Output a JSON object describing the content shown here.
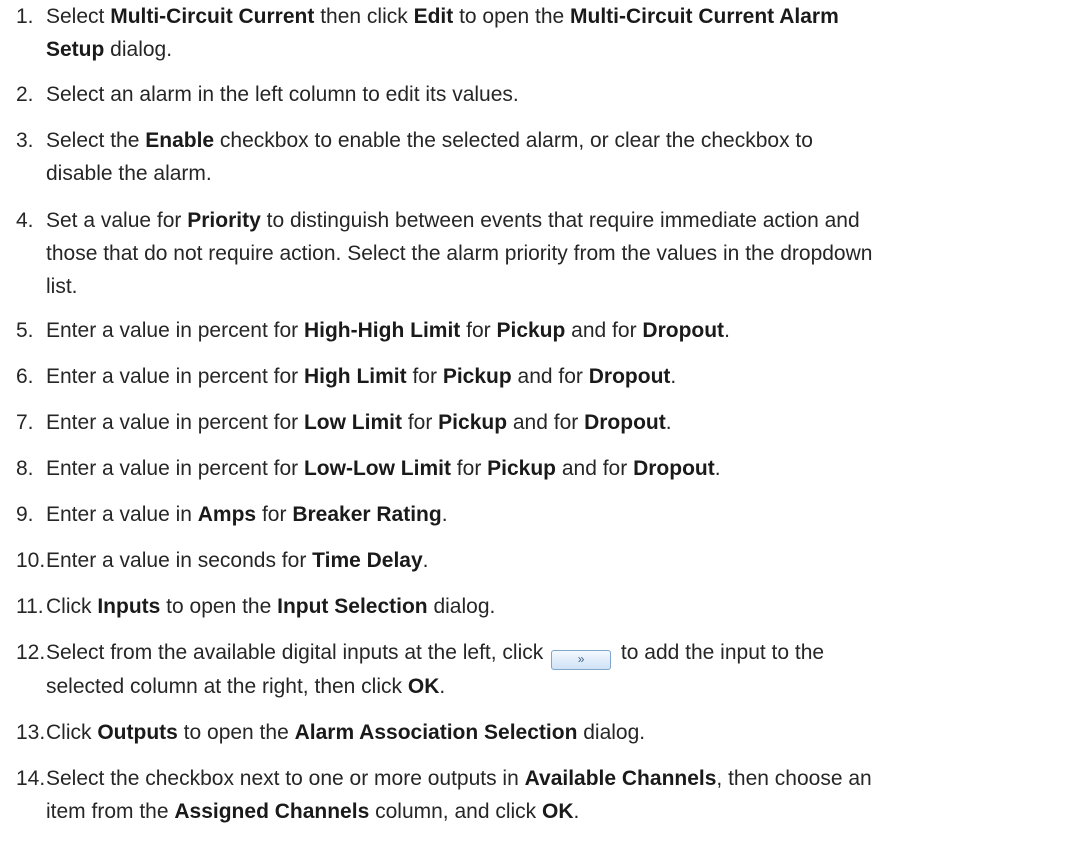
{
  "steps": [
    {
      "num": "1.",
      "parts": [
        {
          "t": "Select "
        },
        {
          "b": "Multi-Circuit Current"
        },
        {
          "t": " then click "
        },
        {
          "b": "Edit"
        },
        {
          "t": " to open the "
        },
        {
          "b": "Multi-Circuit Current Alarm"
        },
        {
          "br": true
        },
        {
          "b": "Setup"
        },
        {
          "t": " dialog."
        }
      ]
    },
    {
      "num": "2.",
      "parts": [
        {
          "t": "Select an alarm in the left column to edit its values."
        }
      ]
    },
    {
      "num": "3.",
      "parts": [
        {
          "t": "Select the "
        },
        {
          "b": "Enable"
        },
        {
          "t": " checkbox to enable the selected alarm, or clear the checkbox to"
        },
        {
          "br": true
        },
        {
          "t": "disable the alarm."
        }
      ]
    },
    {
      "num": "4.",
      "parts": [
        {
          "t": "Set a value for "
        },
        {
          "b": "Priority"
        },
        {
          "t": " to distinguish between events that require immediate action and"
        },
        {
          "br": true
        },
        {
          "t": "those that do not require action. Select the alarm priority from the values in the dropdown"
        },
        {
          "br": true
        },
        {
          "t": "list."
        }
      ]
    },
    {
      "num": "5.",
      "parts": [
        {
          "t": "Enter a value in percent for "
        },
        {
          "b": "High-High Limit"
        },
        {
          "t": " for "
        },
        {
          "b": "Pickup"
        },
        {
          "t": " and for "
        },
        {
          "b": "Dropout"
        },
        {
          "t": "."
        }
      ]
    },
    {
      "num": "6.",
      "parts": [
        {
          "t": "Enter a value in percent for "
        },
        {
          "b": "High Limit"
        },
        {
          "t": " for "
        },
        {
          "b": "Pickup"
        },
        {
          "t": " and for "
        },
        {
          "b": "Dropout"
        },
        {
          "t": "."
        }
      ]
    },
    {
      "num": "7.",
      "parts": [
        {
          "t": "Enter a value in percent for "
        },
        {
          "b": "Low Limit"
        },
        {
          "t": " for "
        },
        {
          "b": "Pickup"
        },
        {
          "t": " and for "
        },
        {
          "b": "Dropout"
        },
        {
          "t": "."
        }
      ]
    },
    {
      "num": "8.",
      "parts": [
        {
          "t": "Enter a value in percent for "
        },
        {
          "b": "Low-Low Limit"
        },
        {
          "t": " for "
        },
        {
          "b": "Pickup"
        },
        {
          "t": " and for "
        },
        {
          "b": "Dropout"
        },
        {
          "t": "."
        }
      ]
    },
    {
      "num": "9.",
      "parts": [
        {
          "t": "Enter a value in "
        },
        {
          "b": "Amps"
        },
        {
          "t": " for "
        },
        {
          "b": "Breaker Rating"
        },
        {
          "t": "."
        }
      ]
    },
    {
      "num": "10.",
      "parts": [
        {
          "t": "Enter a value in seconds for "
        },
        {
          "b": "Time Delay"
        },
        {
          "t": "."
        }
      ]
    },
    {
      "num": "11.",
      "parts": [
        {
          "t": "Click "
        },
        {
          "b": "Inputs"
        },
        {
          "t": " to open the "
        },
        {
          "b": "Input Selection"
        },
        {
          "t": " dialog."
        }
      ]
    },
    {
      "num": "12.",
      "parts": [
        {
          "t": "Select from the available digital inputs at the left, click "
        },
        {
          "btn": "»"
        },
        {
          "t": " to add the input to the"
        },
        {
          "br": true
        },
        {
          "t": "selected column at the right, then click "
        },
        {
          "b": "OK"
        },
        {
          "t": "."
        }
      ]
    },
    {
      "num": "13.",
      "parts": [
        {
          "t": "Click "
        },
        {
          "b": "Outputs"
        },
        {
          "t": " to open the "
        },
        {
          "b": "Alarm Association Selection"
        },
        {
          "t": " dialog."
        }
      ]
    },
    {
      "num": "14.",
      "parts": [
        {
          "t": "Select the checkbox next to one or more outputs in "
        },
        {
          "b": "Available Channels"
        },
        {
          "t": ", then choose an"
        },
        {
          "br": true
        },
        {
          "t": "item from the "
        },
        {
          "b": "Assigned Channels"
        },
        {
          "t": " column, and click "
        },
        {
          "b": "OK"
        },
        {
          "t": "."
        }
      ]
    }
  ]
}
